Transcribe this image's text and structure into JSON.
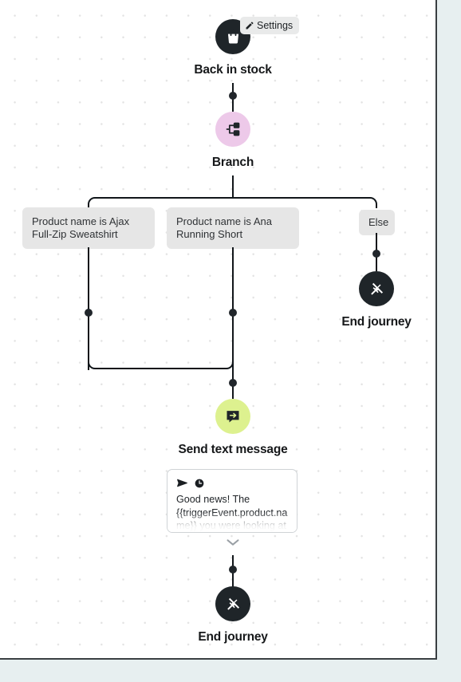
{
  "canvas": {
    "background_color": "#ffffff",
    "dot_color": "#e3e3e3",
    "page_background": "#e7eff0",
    "border_color": "#3a3f42"
  },
  "settings_chip": {
    "label": "Settings",
    "icon": "pencil-icon",
    "background": "#e9eaea"
  },
  "nodes": {
    "trigger": {
      "label": "Back in stock",
      "icon": "shopping-bag-icon",
      "circle_color": "#1f2529",
      "icon_color": "#ffffff"
    },
    "branch": {
      "label": "Branch",
      "icon": "branch-sitemap-icon",
      "circle_color": "#edc9e9",
      "icon_color": "#1f2529"
    },
    "send_text": {
      "label": "Send text message",
      "icon": "message-arrow-icon",
      "circle_color": "#ddf18f",
      "icon_color": "#1f2529"
    },
    "end_journey_else": {
      "label": "End journey",
      "icon": "crossed-flags-icon",
      "circle_color": "#1f2529",
      "icon_color": "#ffffff"
    },
    "end_journey_main": {
      "label": "End journey",
      "icon": "crossed-flags-icon",
      "circle_color": "#1f2529",
      "icon_color": "#ffffff"
    }
  },
  "branches": [
    {
      "id": "branch-1",
      "label": "Product name is Ajax Full-Zip Sweatshirt"
    },
    {
      "id": "branch-2",
      "label": "Product name is Ana Running Short"
    },
    {
      "id": "branch-else",
      "label": "Else"
    }
  ],
  "message_card": {
    "send_icon": "send-paper-plane-icon",
    "schedule_icon": "clock-icon",
    "text": "Good news! The {{triggerEvent.product.name}} you were looking at"
  },
  "expand_control": {
    "icon": "chevron-down-icon",
    "color": "#9aa0a5"
  }
}
